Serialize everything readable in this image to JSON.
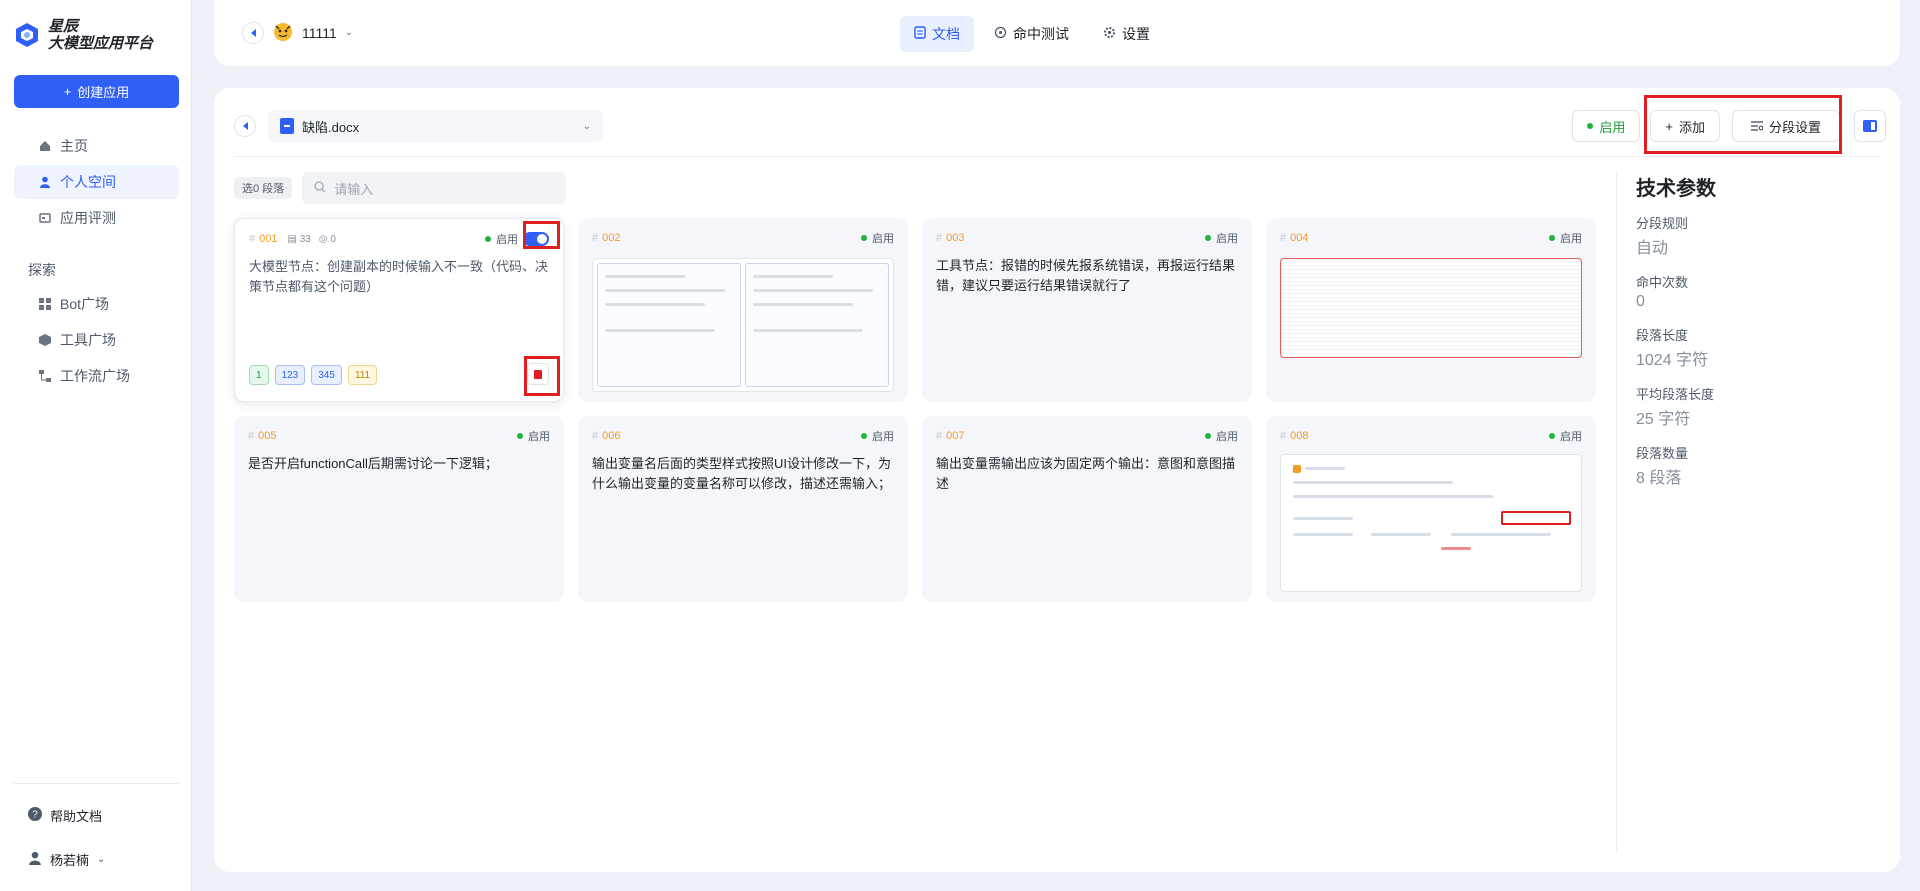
{
  "brand": {
    "line1": "星辰",
    "line2": "大模型应用平台"
  },
  "sidebar": {
    "create_label": "创建应用",
    "items": [
      {
        "label": "主页",
        "icon": "home-icon"
      },
      {
        "label": "个人空间",
        "icon": "user-icon"
      },
      {
        "label": "应用评测",
        "icon": "evaluate-icon"
      }
    ],
    "explore_label": "探索",
    "explore_items": [
      {
        "label": "Bot广场",
        "icon": "grid-icon"
      },
      {
        "label": "工具广场",
        "icon": "box-icon"
      },
      {
        "label": "工作流广场",
        "icon": "workflow-icon"
      }
    ],
    "help_label": "帮助文档",
    "user_name": "杨若楠"
  },
  "header": {
    "app_name": "11111",
    "tabs": [
      {
        "label": "文档",
        "icon": "document-icon"
      },
      {
        "label": "命中测试",
        "icon": "target-icon"
      },
      {
        "label": "设置",
        "icon": "gear-icon"
      }
    ]
  },
  "toolbar": {
    "file_name": "缺陷.docx",
    "enable_label": "启用",
    "add_label": "添加",
    "segment_settings_label": "分段设置"
  },
  "filter": {
    "selected_label": "选0 段落",
    "search_placeholder": "请输入"
  },
  "cards": [
    {
      "id": "001",
      "words": "33",
      "hits": "0",
      "status": "启用",
      "text": "大模型节点：创建副本的时候输入不一致（代码、决策节点都有这个问题）",
      "tags": [
        "1",
        "123",
        "345",
        "111"
      ]
    },
    {
      "id": "002",
      "status": "启用"
    },
    {
      "id": "003",
      "status": "启用",
      "text": "工具节点：报错的时候先报系统错误，再报运行结果错，建议只要运行结果错误就行了"
    },
    {
      "id": "004",
      "status": "启用"
    },
    {
      "id": "005",
      "status": "启用",
      "text": "是否开启functionCall后期需讨论一下逻辑；"
    },
    {
      "id": "006",
      "status": "启用",
      "text": "输出变量名后面的类型样式按照UI设计修改一下，为什么输出变量的变量名称可以修改，描述还需输入；"
    },
    {
      "id": "007",
      "status": "启用",
      "text": "输出变量需输出应该为固定两个输出：意图和意图描述"
    },
    {
      "id": "008",
      "status": "启用"
    }
  ],
  "params": {
    "title": "技术参数",
    "rows": [
      {
        "label": "分段规则",
        "value": "自动"
      },
      {
        "label": "命中次数",
        "value": "0"
      },
      {
        "label": "段落长度",
        "value": "1024 字符"
      },
      {
        "label": "平均段落长度",
        "value": "25 字符"
      },
      {
        "label": "段落数量",
        "value": "8 段落"
      }
    ]
  },
  "colors": {
    "accent": "#2f5ff5",
    "highlight": "#e02020",
    "enabled": "#23b33a",
    "id": "#f59a23"
  }
}
